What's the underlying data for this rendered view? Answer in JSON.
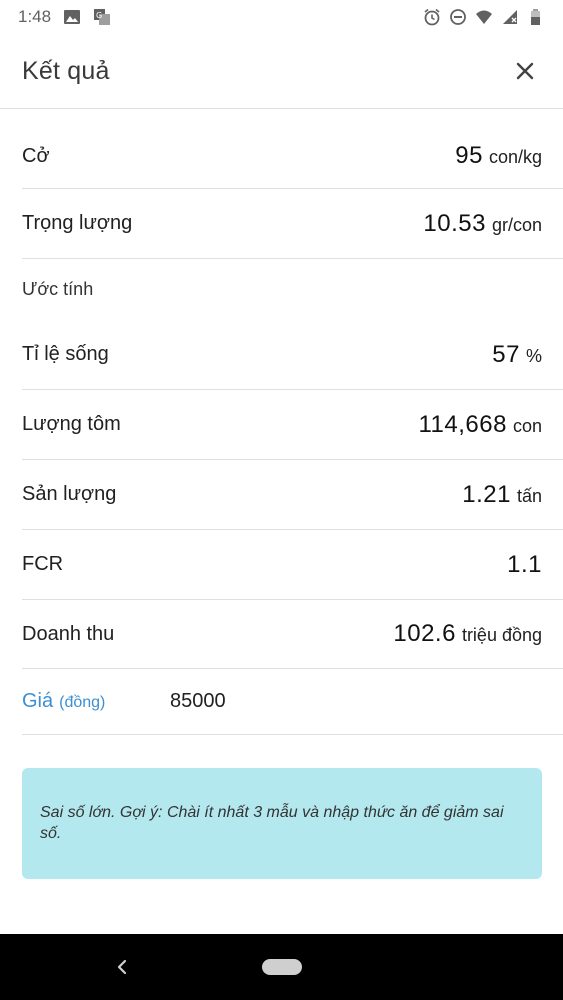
{
  "status_bar": {
    "time": "1:48",
    "icons_left": [
      "image-icon",
      "translate-icon"
    ],
    "icons_right": [
      "alarm-icon",
      "dnd-icon",
      "wifi-icon",
      "signal-icon",
      "battery-icon"
    ]
  },
  "header": {
    "title": "Kết quả",
    "close_icon": "close-icon"
  },
  "rows": {
    "size": {
      "label": "Cở",
      "value": "95",
      "unit": "con/kg"
    },
    "weight": {
      "label": "Trọng lượng",
      "value": "10.53",
      "unit": "gr/con"
    }
  },
  "estimate": {
    "section_label": "Ước tính",
    "survival": {
      "label": "Tỉ lệ sống",
      "value": "57",
      "unit": "%"
    },
    "count": {
      "label": "Lượng tôm",
      "value": "114,668",
      "unit": "con"
    },
    "yield": {
      "label": "Sản lượng",
      "value": "1.21",
      "unit": "tấn"
    },
    "fcr": {
      "label": "FCR",
      "value": "1.1",
      "unit": ""
    },
    "revenue": {
      "label": "Doanh thu",
      "value": "102.6",
      "unit": "triệu đồng"
    }
  },
  "price": {
    "label": "Giá",
    "unit": "(đồng)",
    "value": "85000"
  },
  "note": {
    "text": "Sai số lớn. Gợi ý: Chài ít nhất 3 mẫu và nhập thức ăn để giảm sai số."
  },
  "colors": {
    "accent": "#3d8fd1",
    "note_bg": "#b4e8ef",
    "divider": "#e0e0e0"
  }
}
